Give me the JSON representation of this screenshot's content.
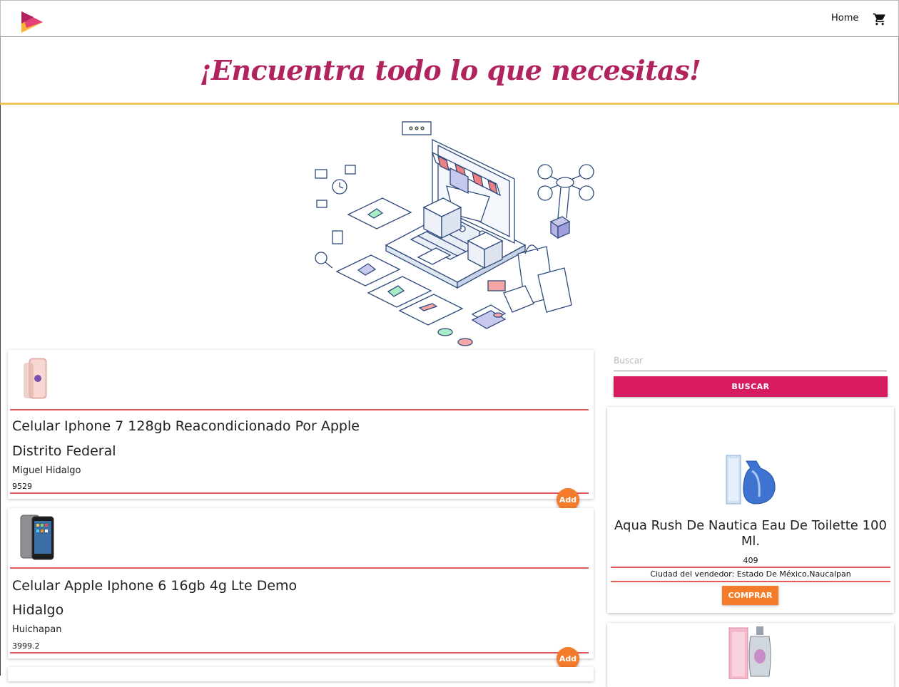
{
  "nav": {
    "home_label": "Home",
    "cart_icon": "cart-icon"
  },
  "banner": {
    "title": "¡Encuentra todo lo que necesitas!"
  },
  "search": {
    "placeholder": "Buscar",
    "button_label": "BUSCAR"
  },
  "products": [
    {
      "title": "Celular Iphone 7 128gb Reacondicionado Por Apple",
      "state": "Distrito Federal",
      "city": "Miguel Hidalgo",
      "price": "9529",
      "add_label": "Add"
    },
    {
      "title": "Celular Apple Iphone 6 16gb 4g Lte Demo",
      "state": "Hidalgo",
      "city": "Huichapan",
      "price": "3999.2",
      "add_label": "Add"
    }
  ],
  "featured": [
    {
      "title": "Aqua Rush De Nautica Eau De Toilette 100 Ml.",
      "price": "409",
      "seller": "Ciudad del vendedor: Estado De México,Naucalpan",
      "button_label": "COMPRAR"
    }
  ],
  "colors": {
    "accent": "#d81b60",
    "title": "#b0235e",
    "orange": "#f47b2a",
    "rule": "#e05a5a"
  }
}
